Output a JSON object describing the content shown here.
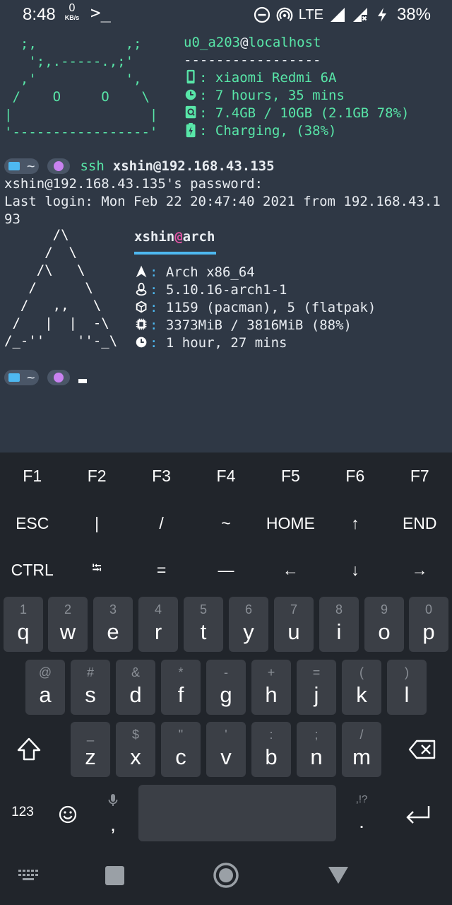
{
  "status_bar": {
    "time": "8:48",
    "net_speed_value": "0",
    "net_speed_unit": "KB/s",
    "terminal_glyph": ">_",
    "network": "LTE",
    "battery": "38%"
  },
  "terminal": {
    "host_header": {
      "user": "u0_a203",
      "at": "@",
      "host": "localhost",
      "rule": "-----------------"
    },
    "android_logo_lines": [
      "  ;,           ,;",
      "   ';,.-----.,;'",
      "  ,'           ',",
      " /    O     O    \\",
      "|                 |",
      "'-----------------'"
    ],
    "neofetch_android": [
      {
        "icon": "phone-icon",
        "text": ": xiaomi Redmi 6A"
      },
      {
        "icon": "clock-icon",
        "text": ": 7 hours, 35 mins"
      },
      {
        "icon": "memory-icon",
        "text": ": 7.4GB / 10GB (2.1GB 78%)"
      },
      {
        "icon": "battery-icon",
        "text": ": Charging, (38%)"
      }
    ],
    "prompt_dir": "~",
    "command_name": "ssh",
    "command_arg": "xshin@192.168.43.135",
    "password_line": "xshin@192.168.43.135's password:",
    "last_login_line1": "Last login: Mon Feb 22 20:47:40 2021 from 192.168.43.1",
    "last_login_line2": "93",
    "arch_logo_lines": [
      "      /\\",
      "     /  \\",
      "    /\\   \\",
      "   /      \\",
      "  /   ,,   \\",
      " /   |  |  -\\",
      "/_-''    ''-_\\"
    ],
    "arch_header": {
      "user": "xshin",
      "at": "@",
      "host": "arch"
    },
    "neofetch_arch": [
      {
        "icon": "arch-icon",
        "text": "Arch x86_64"
      },
      {
        "icon": "penguin-icon",
        "text": "5.10.16-arch1-1"
      },
      {
        "icon": "package-icon",
        "text": "1159 (pacman), 5 (flatpak)"
      },
      {
        "icon": "chip-icon",
        "text": "3373MiB / 3816MiB (88%)"
      },
      {
        "icon": "clock-icon",
        "text": "1 hour, 27 mins"
      }
    ]
  },
  "extra_keys": {
    "row1": [
      "F1",
      "F2",
      "F3",
      "F4",
      "F5",
      "F6",
      "F7"
    ],
    "row2": [
      "ESC",
      "|",
      "/",
      "~",
      "HOME",
      "↑",
      "END"
    ],
    "row3": [
      "CTRL",
      "⭾",
      "=",
      "—",
      "←",
      "↓",
      "→"
    ]
  },
  "keyboard": {
    "row1": [
      {
        "hint": "1",
        "key": "q"
      },
      {
        "hint": "2",
        "key": "w"
      },
      {
        "hint": "3",
        "key": "e"
      },
      {
        "hint": "4",
        "key": "r"
      },
      {
        "hint": "5",
        "key": "t"
      },
      {
        "hint": "6",
        "key": "y"
      },
      {
        "hint": "7",
        "key": "u"
      },
      {
        "hint": "8",
        "key": "i"
      },
      {
        "hint": "9",
        "key": "o"
      },
      {
        "hint": "0",
        "key": "p"
      }
    ],
    "row2": [
      {
        "hint": "@",
        "key": "a"
      },
      {
        "hint": "#",
        "key": "s"
      },
      {
        "hint": "&",
        "key": "d"
      },
      {
        "hint": "*",
        "key": "f"
      },
      {
        "hint": "-",
        "key": "g"
      },
      {
        "hint": "+",
        "key": "h"
      },
      {
        "hint": "=",
        "key": "j"
      },
      {
        "hint": "(",
        "key": "k"
      },
      {
        "hint": ")",
        "key": "l"
      }
    ],
    "row3": [
      {
        "hint": "_",
        "key": "z"
      },
      {
        "hint": "$",
        "key": "x"
      },
      {
        "hint": "\"",
        "key": "c"
      },
      {
        "hint": "'",
        "key": "v"
      },
      {
        "hint": ":",
        "key": "b"
      },
      {
        "hint": ";",
        "key": "n"
      },
      {
        "hint": "/",
        "key": "m"
      }
    ],
    "symbols_label": "123",
    "comma": ",",
    "period": ".",
    "period_hint": ",!?"
  }
}
